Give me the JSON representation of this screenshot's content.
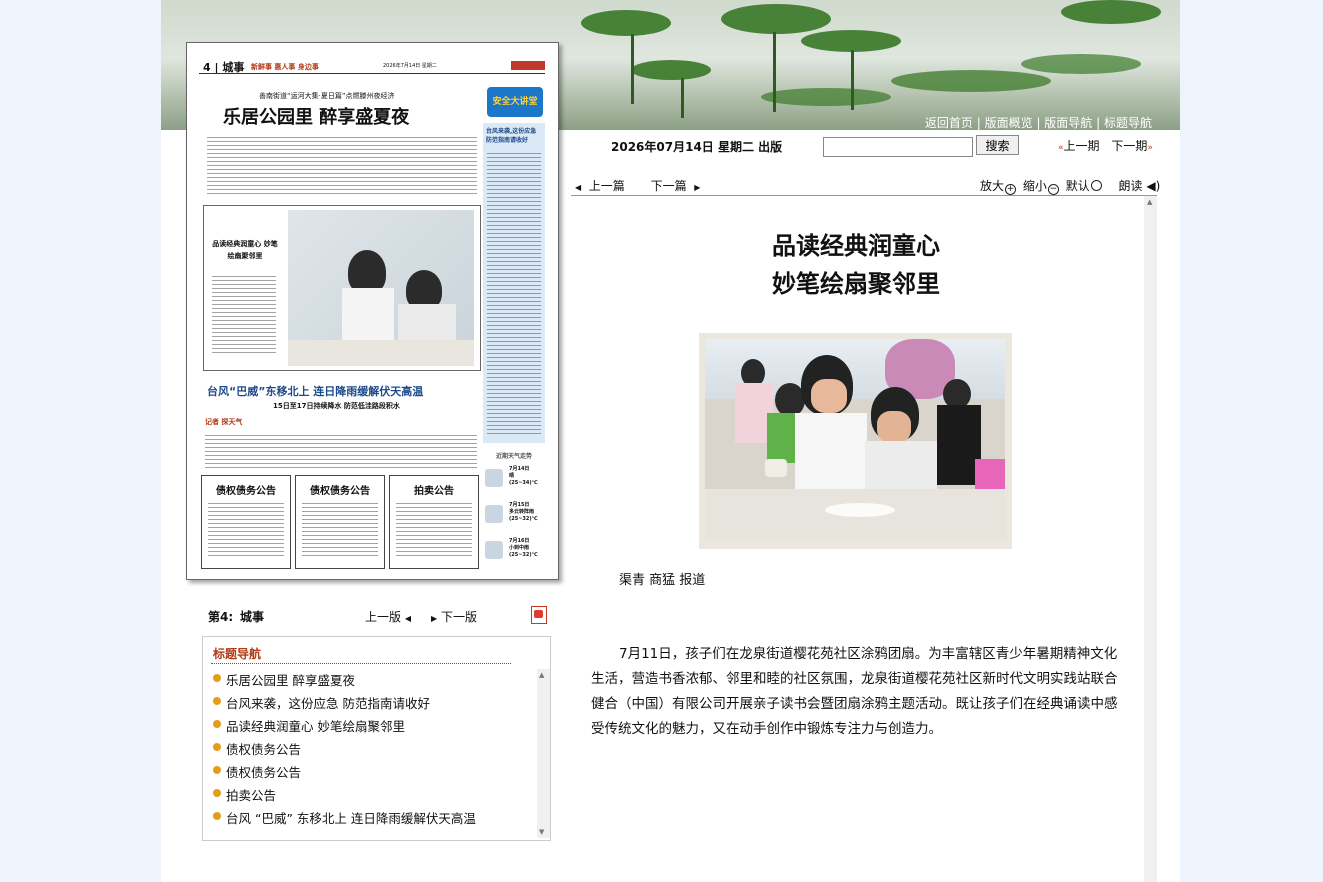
{
  "banner": {
    "links": [
      "返回首页",
      "版面概览",
      "版面导航",
      "标题导航"
    ],
    "separator": " | "
  },
  "newspaper": {
    "page_no": "4",
    "section": "城事",
    "slogan": "新鲜事 惠人事 身边事",
    "masthead_info": "2026年7月14日  星期二",
    "kicker": "善南街道“运河大集·夏日篇”点燃滕州夜经济",
    "headline": "乐居公园里 醉享盛夏夜",
    "badge": "安全大讲堂",
    "sidebar_title": "台风来袭,这份应急防范指南请收好",
    "photo_caption_title": "品读经典润童心 妙笔绘扇聚邻里",
    "typhoon_headline": "台风“巴威”东移北上 连日降雨缓解伏天高温",
    "typhoon_sub": "15日至17日持续降水 防范低洼路段积水",
    "reporter_tag": "记者 探天气",
    "weather_title": "近期天气走势",
    "weather": [
      {
        "date": "7月14日",
        "desc": "晴",
        "temp": "(25~34)℃"
      },
      {
        "date": "7月15日",
        "desc": "多云转阵雨",
        "temp": "(25~32)℃"
      },
      {
        "date": "7月16日",
        "desc": "小到中雨",
        "temp": "(25~32)℃"
      }
    ],
    "ads": [
      "债权债务公告",
      "债权债务公告",
      "拍卖公告"
    ]
  },
  "page_nav": {
    "label": "第4:",
    "section": "城事",
    "prev": "上一版",
    "next": "下一版",
    "pdf_icon": "pdf-icon"
  },
  "title_nav": {
    "heading": "标题导航",
    "items": [
      "乐居公园里 醉享盛夏夜",
      "台风来袭，这份应急 防范指南请收好",
      "品读经典润童心 妙笔绘扇聚邻里",
      "债权债务公告",
      "债权债务公告",
      "拍卖公告",
      "台风 “巴威” 东移北上 连日降雨缓解伏天高温"
    ]
  },
  "header": {
    "date": "2026年07月14日 星期二 出版",
    "search_value": "",
    "search_button": "搜索",
    "prev_issue": "上一期",
    "next_issue": "下一期"
  },
  "article_nav": {
    "prev": "上一篇",
    "next": "下一篇"
  },
  "toolbar": {
    "zoom_in": "放大",
    "zoom_out": "缩小",
    "default": "默认",
    "read": "朗读"
  },
  "article": {
    "title_line1": "品读经典润童心",
    "title_line2": "妙笔绘扇聚邻里",
    "author": "渠青 商猛 报道",
    "body": "7月11日，孩子们在龙泉街道樱花苑社区涂鸦团扇。为丰富辖区青少年暑期精神文化生活，营造书香浓郁、邻里和睦的社区氛围，龙泉街道樱花苑社区新时代文明实践站联合健合（中国）有限公司开展亲子读书会暨团扇涂鸦主题活动。既让孩子们在经典诵读中感受传统文化的魅力，又在动手创作中锻炼专注力与创造力。"
  },
  "colors": {
    "accent": "#b23b16",
    "bullet": "#e59c18",
    "headline_blue": "#1c4a8a",
    "page_bg": "#eef4fb"
  }
}
